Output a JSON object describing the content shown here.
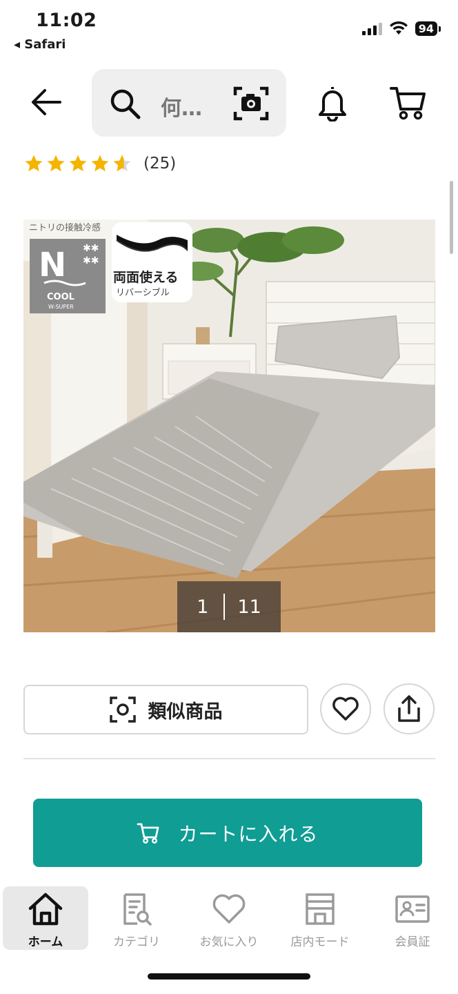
{
  "status_bar": {
    "time": "11:02",
    "back_app": "◂ Safari",
    "battery": "94",
    "icons": [
      "signal-icon",
      "wifi-icon",
      "battery-icon"
    ]
  },
  "header": {
    "back_icon": "back-arrow-icon",
    "search_placeholder": "何…",
    "search_icon": "search-icon",
    "camera_icon": "camera-search-icon",
    "bell_icon": "bell-icon",
    "cart_icon": "cart-icon"
  },
  "rating": {
    "stars": 4.5,
    "max_stars": 5,
    "count": "(25)",
    "star_color": "#f5b400"
  },
  "product_image": {
    "badge_label": "ニトリの接触冷感",
    "badge_n": "N",
    "badge_cool": "COOL",
    "badge_super": "W-SUPER",
    "reversible_main": "両面使える",
    "reversible_sub": "リバーシブル",
    "counter_current": "1",
    "counter_total": "11"
  },
  "actions": {
    "similar_label": "類似商品",
    "similar_icon": "scan-icon",
    "favorite_icon": "heart-icon",
    "share_icon": "share-icon"
  },
  "add_to_cart": {
    "label": "カートに入れる",
    "icon": "cart-icon",
    "color": "#0f9d94"
  },
  "tab_bar": {
    "items": [
      {
        "label": "ホーム",
        "icon": "home-icon",
        "active": true
      },
      {
        "label": "カテゴリ",
        "icon": "category-icon",
        "active": false
      },
      {
        "label": "お気に入り",
        "icon": "heart-icon",
        "active": false
      },
      {
        "label": "店内モード",
        "icon": "store-icon",
        "active": false
      },
      {
        "label": "会員証",
        "icon": "member-card-icon",
        "active": false
      }
    ]
  }
}
